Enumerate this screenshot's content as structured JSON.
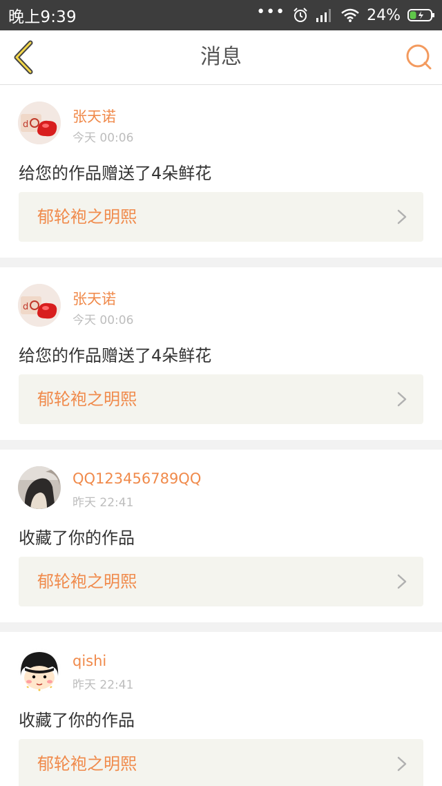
{
  "status_bar": {
    "time": "晚上9:39",
    "more": "•••",
    "battery_percent": "24%",
    "icons": [
      "alarm-icon",
      "signal-icon",
      "wifi-icon",
      "battery-charging-icon"
    ]
  },
  "nav": {
    "title": "消息",
    "back_icon": "back-chevron-icon",
    "search_icon": "search-icon",
    "accent_color": "#f08a4b"
  },
  "messages": [
    {
      "user": "张天诺",
      "time": "今天 00:06",
      "text": "给您的作品赠送了4朵鲜花",
      "work": "郁轮袍之明熙",
      "avatar": "heart-avatar"
    },
    {
      "user": "张天诺",
      "time": "今天 00:06",
      "text": "给您的作品赠送了4朵鲜花",
      "work": "郁轮袍之明熙",
      "avatar": "heart-avatar"
    },
    {
      "user": "QQ123456789QQ",
      "time": "昨天 22:41",
      "text": "收藏了你的作品",
      "work": "郁轮袍之明熙",
      "avatar": "photo-avatar"
    },
    {
      "user": "qishi",
      "time": "昨天 22:41",
      "text": "收藏了你的作品",
      "work": "郁轮袍之明熙",
      "avatar": "cartoon-avatar"
    }
  ]
}
